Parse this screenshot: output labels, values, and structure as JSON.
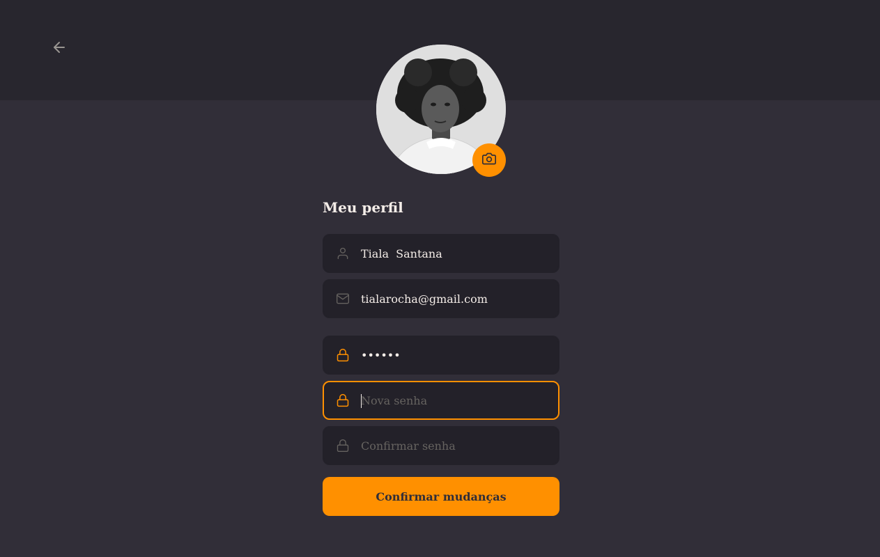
{
  "colors": {
    "background": "#312e38",
    "header": "#28262e",
    "input_background": "#232129",
    "accent": "#ff9000",
    "text": "#f4ede8",
    "muted": "#666360"
  },
  "header": {
    "back_icon": "arrow-left-icon"
  },
  "profile": {
    "avatar_alt": "profile photo",
    "camera_icon": "camera-icon"
  },
  "form": {
    "title": "Meu perfil",
    "name": {
      "icon": "user-icon",
      "value": "Tiala  Santana"
    },
    "email": {
      "icon": "mail-icon",
      "value": "tialarocha@gmail.com"
    },
    "old_password": {
      "icon": "lock-icon",
      "value": "••••••"
    },
    "new_password": {
      "icon": "lock-icon",
      "placeholder": "Nova senha",
      "value": ""
    },
    "confirm_password": {
      "icon": "lock-icon",
      "placeholder": "Confirmar senha",
      "value": ""
    },
    "submit_label": "Confirmar mudanças"
  }
}
